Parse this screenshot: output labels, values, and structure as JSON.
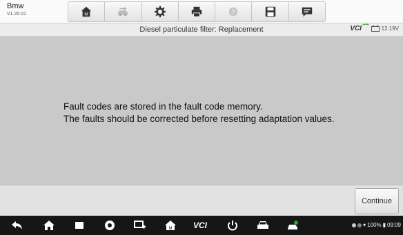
{
  "app": {
    "name": "Bmw",
    "version": "V1.20.01"
  },
  "toolbar": {
    "icons": [
      "home-icon",
      "vehicle-swap-icon",
      "settings-icon",
      "print-icon",
      "help-icon",
      "save-icon",
      "message-icon"
    ]
  },
  "subheader": {
    "title": "Diesel particulate filter: Replacement",
    "vci_label": "VCI",
    "battery_voltage": "12.19V"
  },
  "message": {
    "line1": "Fault codes are stored in the fault code memory.",
    "line2": "The faults should be corrected before resetting adaptation values."
  },
  "footer": {
    "continue_label": "Continue"
  },
  "navbar": {
    "vci_label": "VCI"
  },
  "statusbar": {
    "battery": "100%",
    "time": "09:09"
  },
  "colors": {
    "accent": "#2fa32f",
    "background": "#c9c9c9",
    "navbar": "#161616"
  }
}
